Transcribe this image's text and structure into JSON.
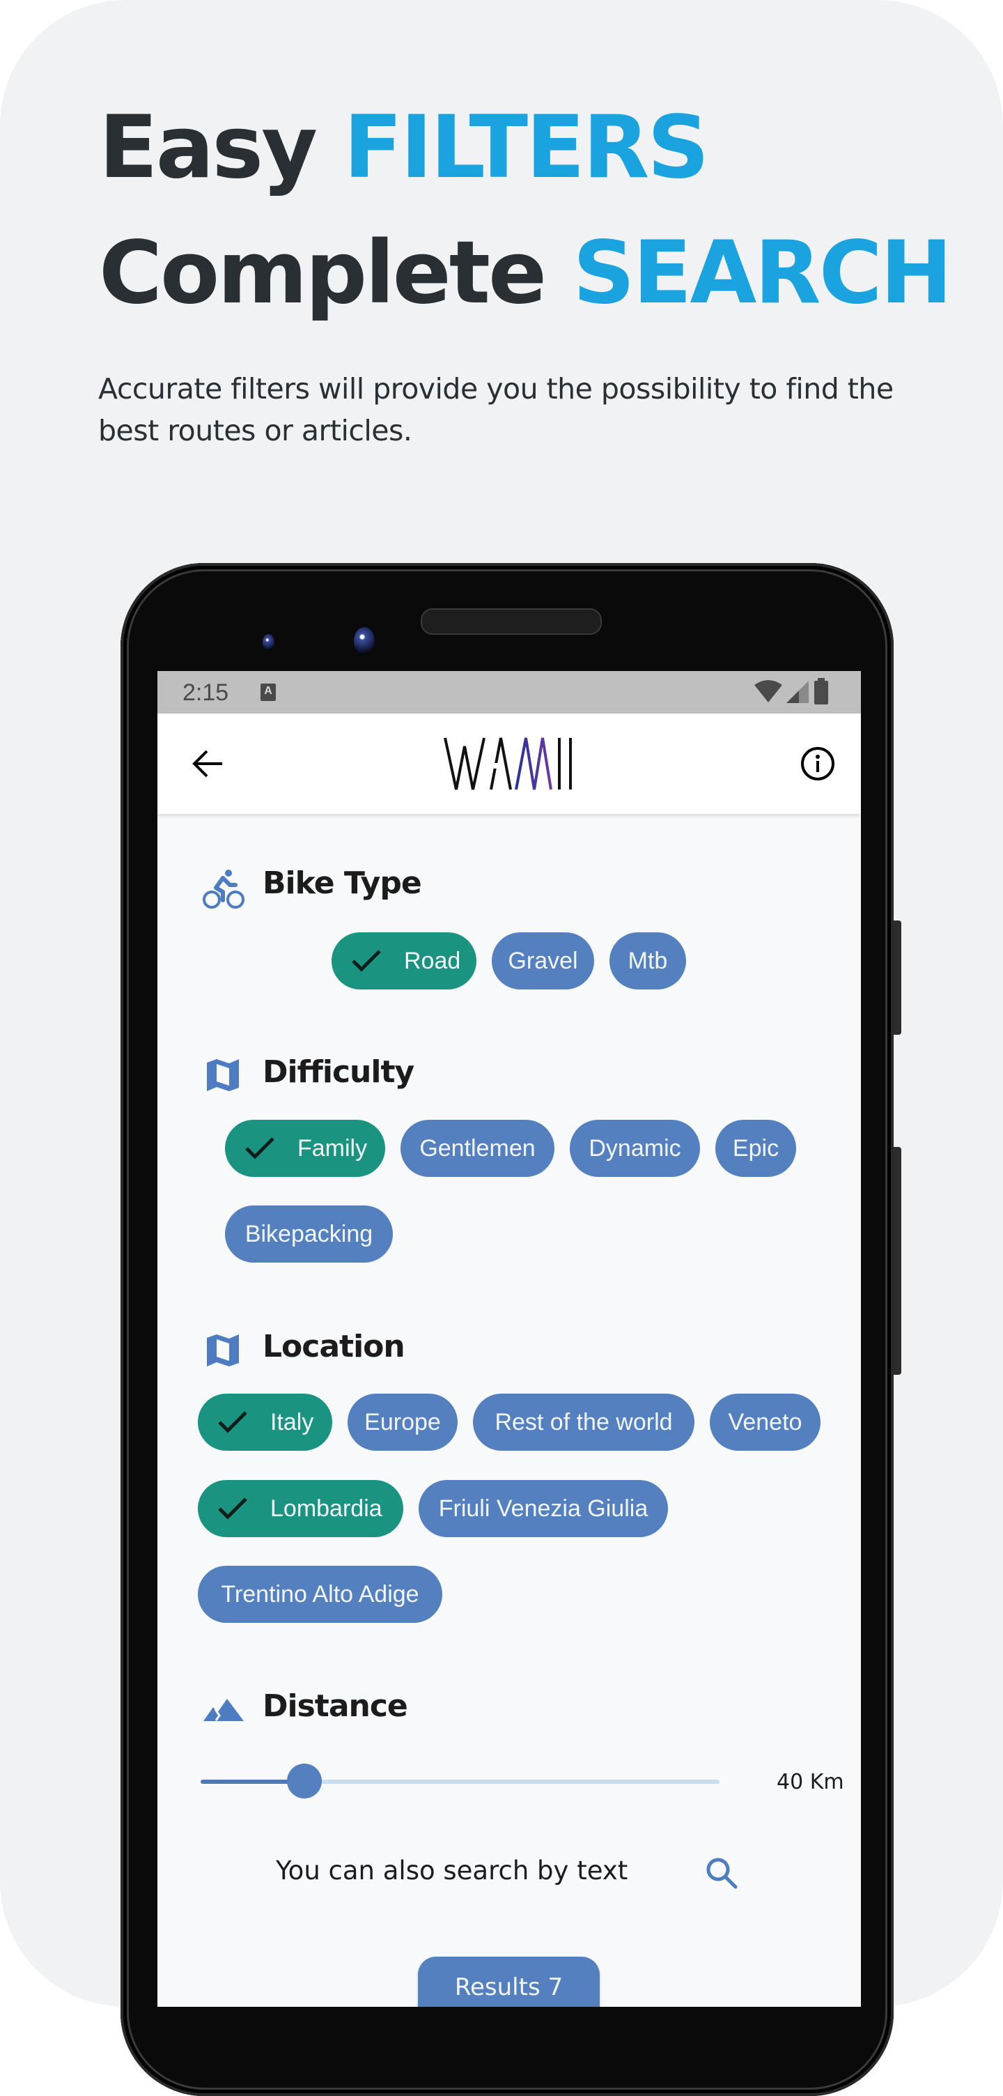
{
  "promo": {
    "headline_line1_plain": "Easy",
    "headline_line1_accent": "FILTERS",
    "headline_line2_plain": "Complete",
    "headline_line2_accent": "SEARCH",
    "subtitle": "Accurate filters will provide you the possibility to find the best routes or articles.",
    "accent_color": "#1aa3de"
  },
  "statusbar": {
    "time": "2:15",
    "notification_icon": "A",
    "icons": [
      "wifi-icon",
      "signal-icon",
      "battery-icon"
    ]
  },
  "appbar": {
    "logo_text": "WAMII",
    "back_icon": "arrow-left-icon",
    "info_icon": "info-circle-icon"
  },
  "sections": {
    "bike_type": {
      "title": "Bike Type",
      "icon": "bike-icon",
      "chips": [
        {
          "label": "Road",
          "selected": true
        },
        {
          "label": "Gravel",
          "selected": false
        },
        {
          "label": "Mtb",
          "selected": false
        }
      ]
    },
    "difficulty": {
      "title": "Difficulty",
      "icon": "map-icon",
      "chips": [
        {
          "label": "Family",
          "selected": true
        },
        {
          "label": "Gentlemen",
          "selected": false
        },
        {
          "label": "Dynamic",
          "selected": false
        },
        {
          "label": "Epic",
          "selected": false
        },
        {
          "label": "Bikepacking",
          "selected": false
        }
      ]
    },
    "location": {
      "title": "Location",
      "icon": "map-icon",
      "chips": [
        {
          "label": "Italy",
          "selected": true
        },
        {
          "label": "Europe",
          "selected": false
        },
        {
          "label": "Rest of the world",
          "selected": false
        },
        {
          "label": "Veneto",
          "selected": false
        },
        {
          "label": "Lombardia",
          "selected": true
        },
        {
          "label": "Friuli Venezia Giulia",
          "selected": false
        },
        {
          "label": "Trentino Alto Adige",
          "selected": false
        }
      ]
    },
    "distance": {
      "title": "Distance",
      "icon": "mountain-icon",
      "slider_fraction": 0.2,
      "value_label": "40 Km"
    }
  },
  "search": {
    "label": "You can also search by text",
    "icon": "search-icon"
  },
  "results_button": {
    "label": "Results 7"
  },
  "colors": {
    "chip_selected": "#1a9480",
    "chip_default": "#5480c0",
    "primary": "#5480c0"
  }
}
